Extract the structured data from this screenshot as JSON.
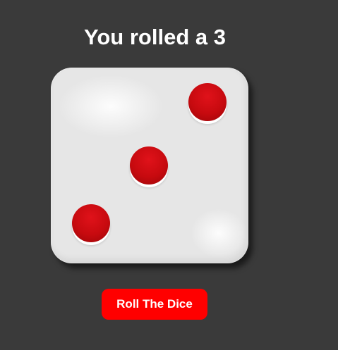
{
  "result": {
    "title": "You rolled a 3",
    "rolled_value": 3
  },
  "die": {
    "face": 3,
    "face_color": "#e6e6e6",
    "pip_color": "#c70a0f",
    "pips": [
      "top-right",
      "center",
      "bottom-left"
    ]
  },
  "controls": {
    "roll_button_label": "Roll The Dice",
    "button_color": "#ff0000"
  },
  "theme": {
    "background": "#3a3a3a"
  }
}
